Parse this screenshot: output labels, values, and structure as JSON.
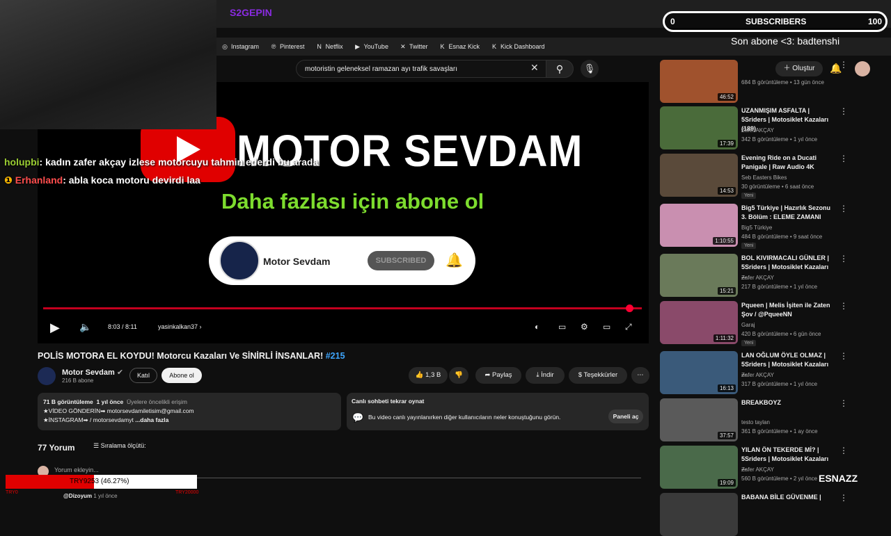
{
  "browser": {
    "tab_title": "S2GEPIN",
    "bookmarks": [
      {
        "label": "Instagram",
        "icon": "instagram-icon",
        "glyph": "◎"
      },
      {
        "label": "Pinterest",
        "icon": "pinterest-icon",
        "glyph": "℗"
      },
      {
        "label": "Netflix",
        "icon": "netflix-icon",
        "glyph": "N"
      },
      {
        "label": "YouTube",
        "icon": "youtube-icon",
        "glyph": "▶"
      },
      {
        "label": "Twitter",
        "icon": "x-icon",
        "glyph": "✕"
      },
      {
        "label": "Esnaz Kick",
        "icon": "kick-icon",
        "glyph": "K"
      },
      {
        "label": "Kick Dashboard",
        "icon": "kick-icon",
        "glyph": "K"
      }
    ]
  },
  "header": {
    "search_query": "motoristin geleneksel ramazan ayı trafik savaşları",
    "create_label": "Oluştur"
  },
  "video": {
    "overlay_title": "MOTOR SEVDAM",
    "overlay_subtitle": "Daha fazlası için abone ol",
    "card_channel": "Motor Sevdam",
    "card_button": "SUBSCRIBED",
    "time": "8:03 / 8:11",
    "chapter": "yasinkalkan37",
    "progress": 0.98
  },
  "meta": {
    "title": "POLİS MOTORA EL KOYDU! Motorcu Kazaları Ve SİNİRLİ İNSANLAR!",
    "hashtag": "#215",
    "channel": "Motor Sevdam",
    "subs": "216 B abone",
    "join": "Katıl",
    "subscribe": "Abone ol",
    "likes": "1,3 B",
    "share": "Paylaş",
    "download": "İndir",
    "thanks": "Teşekkürler"
  },
  "desc": {
    "views": "71 B görüntüleme",
    "age": "1 yıl önce",
    "members": "Üyelere öncelikli erişim",
    "line1": "★VİDEO GÖNDERİN➡ motorsevdamiletisim@gmail.com",
    "line2": "★İNSTAGRAM➡  / motorsevdamyt",
    "more": "...daha fazla"
  },
  "chat_replay": {
    "title": "Canlı sohbeti tekrar oynat",
    "body": "Bu video canlı yayınlanırken diğer kullanıcıların neler konuştuğunu görün.",
    "button": "Paneli aç"
  },
  "comments": {
    "count": "77 Yorum",
    "sort": "Sıralama ölçütü:",
    "add": "Yorum ekleyin...",
    "first_user": "@Dizoyum",
    "first_age": "1 yıl önce"
  },
  "sidebar": [
    {
      "title": "",
      "channel": "",
      "meta": "684 B görüntüleme • 13 gün önce",
      "dur": "46:52",
      "isnew": "",
      "color": "#a0522d"
    },
    {
      "title": "UZANMIŞIM ASFALTA | 5Sriders | Motosiklet Kazaları (189)",
      "channel": "Zafer AKÇAY",
      "meta": "342 B görüntüleme • 1 yıl önce",
      "dur": "17:39",
      "isnew": "",
      "color": "#4a6b3a"
    },
    {
      "title": "Evening Ride on a Ducati Panigale | Raw Audio 4K",
      "channel": "Seb Easters Bikes",
      "meta": "30 görüntüleme • 6 saat önce",
      "dur": "14:53",
      "isnew": "Yeni",
      "color": "#5a4a3a"
    },
    {
      "title": "Big5 Türkiye | Hazırlık Sezonu 3. Bölüm : ELEME ZAMANI",
      "channel": "Big5 Türkiye",
      "meta": "484 B görüntüleme • 9 saat önce",
      "dur": "1:10:55",
      "isnew": "Yeni",
      "color": "#c98fb0"
    },
    {
      "title": "BOL KIVIRMACALI GÜNLER | 5Sriders | Motosiklet Kazaları ...",
      "channel": "Zafer AKÇAY",
      "meta": "217 B görüntüleme • 1 yıl önce",
      "dur": "15:21",
      "isnew": "",
      "color": "#6a7a5a"
    },
    {
      "title": "Pqueen | Melis İşiten ile Zaten Şov / @PqueeNN",
      "channel": "Garaj",
      "meta": "420 B görüntüleme • 6 gün önce",
      "dur": "1:11:32",
      "isnew": "Yeni",
      "color": "#8a4a6a"
    },
    {
      "title": "LAN OĞLUM ÖYLE OLMAZ | 5Sriders | Motosiklet Kazaları ...",
      "channel": "Zafer AKÇAY",
      "meta": "317 B görüntüleme • 1 yıl önce",
      "dur": "16:13",
      "isnew": "",
      "color": "#3a5a7a"
    },
    {
      "title": "BREAKBOYZ",
      "channel": "testo taylan",
      "meta": "361 B görüntüleme • 1 ay önce",
      "dur": "37:57",
      "isnew": "",
      "color": "#5a5a5a"
    },
    {
      "title": "YILAN ÖN TEKERDE Mİ? | 5Sriders | Motosiklet Kazaları ...",
      "channel": "Zafer AKÇAY",
      "meta": "560 B görüntüleme • 2 yıl önce",
      "dur": "19:09",
      "isnew": "",
      "color": "#4a6a4a"
    },
    {
      "title": "BABANA BİLE GÜVENME |",
      "channel": "",
      "meta": "",
      "dur": "",
      "isnew": "",
      "color": "#3a3a3a"
    }
  ],
  "overlay": {
    "subs_min": "0",
    "subs_label": "SUBSCRIBERS",
    "subs_max": "100",
    "last_sub": "Son abone <3: badtenshi",
    "chat1_user": "holupbi",
    "chat1_msg": ": kadın zafer akçay izlese motorcuyu tahmin ederdi bu arada",
    "chat2_user": "Erhanland",
    "chat2_msg": ": abla koca motoru devirdi laa",
    "donate_text": "TRY9253 (46.27%)",
    "donate_fraction": 0.4627,
    "donate_min": "TRY0",
    "donate_max": "TRY20000",
    "brand": "ESNAZZ",
    "colors": {
      "accent": "#ff0033",
      "link": "#3ea6ff",
      "green": "#7ddc2e",
      "chat1": "#9acd32",
      "chat2": "#ff4d4d"
    }
  }
}
